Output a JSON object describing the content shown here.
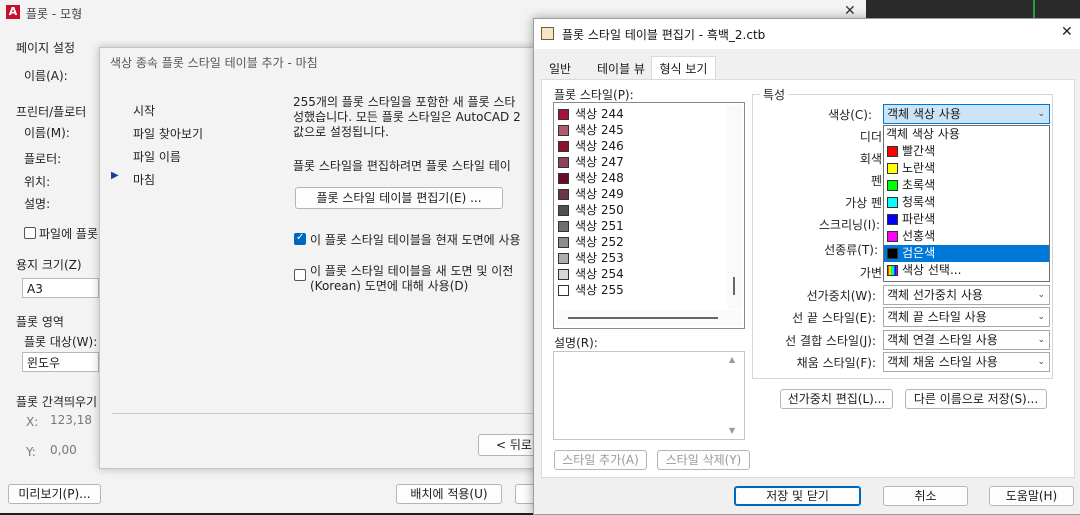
{
  "plot": {
    "title": "플롯 - 모형",
    "page_setup_group": "페이지 설정",
    "name_label": "이름(A):",
    "printer_group": "프린터/플로터",
    "printer_name_label": "이름(M):",
    "plotter_label": "플로터:",
    "location_label": "위치:",
    "description_label": "설명:",
    "plot_to_file": "파일에 플롯",
    "paper_size_group": "용지 크기(Z)",
    "paper_size_value": "A3",
    "plot_area_group": "플롯 영역",
    "plot_what_label": "플롯 대상(W):",
    "plot_what_value": "윈도우",
    "plot_offset_group": "플롯 간격띄우기",
    "x_label": "X:",
    "x_value": "123,18",
    "y_label": "Y:",
    "y_value": "0,00",
    "preview_button": "미리보기(P)...",
    "apply_layout_button": "배치에 적용(U)"
  },
  "wizard": {
    "title": "색상 종속 플롯 스타일 테이블 추가 - 마침",
    "steps": [
      "시작",
      "파일 찾아보기",
      "파일 이름",
      "마침"
    ],
    "active_step_marker": "▶",
    "info_line1": "255개의 플롯 스타일을 포함한 새 플롯 스타",
    "info_line2": "성했습니다. 모든 플롯 스타일은 AutoCAD 2",
    "info_line3": "값으로 설정됩니다.",
    "edit_hint": "플롯 스타일을 편집하려면 플롯 스타일 테이",
    "edit_button": "플롯 스타일 테이블 편집기(E) ...",
    "use_current_checkbox": "이 플롯 스타일 테이블을 현재 도면에 사용",
    "use_new_line1": "이 플롯 스타일 테이블을 새 도면 및 이전",
    "use_new_line2": "(Korean) 도면에 대해 사용(D)",
    "back_button": "< 뒤로"
  },
  "editor": {
    "title": "플롯 스타일 테이블 편집기 - 흑백_2.ctb",
    "close_glyph": "✕",
    "tabs": [
      "일반",
      "테이블 뷰",
      "형식 보기"
    ],
    "active_tab": "형식 보기",
    "plot_styles_label": "플롯 스타일(P):",
    "styles": [
      {
        "name": "색상 244",
        "color": "#a8123a"
      },
      {
        "name": "색상 245",
        "color": "#b25a6e"
      },
      {
        "name": "색상 246",
        "color": "#8e0f2e"
      },
      {
        "name": "색상 247",
        "color": "#8e4358"
      },
      {
        "name": "색상 248",
        "color": "#6d0c24"
      },
      {
        "name": "색상 249",
        "color": "#6d3544"
      },
      {
        "name": "색상 250",
        "color": "#4f4f4f"
      },
      {
        "name": "색상 251",
        "color": "#6f6f6f"
      },
      {
        "name": "색상 252",
        "color": "#8c8c8c"
      },
      {
        "name": "색상 253",
        "color": "#adadad"
      },
      {
        "name": "색상 254",
        "color": "#d6d6d6"
      },
      {
        "name": "색상 255",
        "color": "#ffffff"
      }
    ],
    "description_label": "설명(R):",
    "add_style_button": "스타일 추가(A)",
    "delete_style_button": "스타일 삭제(Y)",
    "properties_group": "특성",
    "color_label": "색상(C):",
    "color_value": "객체 색상 사용",
    "partial_labels": [
      "디더",
      "회색",
      "펜",
      "가상 펜",
      "스크리닝(I):",
      "선종류(T):",
      "가변"
    ],
    "lineweight_label": "선가중치(W):",
    "lineweight_value": "객체 선가중치 사용",
    "line_end_label": "선 끝 스타일(E):",
    "line_end_value": "객체 끝 스타일 사용",
    "line_join_label": "선 결합 스타일(J):",
    "line_join_value": "객체 연결 스타일 사용",
    "fill_label": "채움 스타일(F):",
    "fill_value": "객체 채움 스타일 사용",
    "edit_lineweights_button": "선가중치 편집(L)...",
    "save_as_button": "다른 이름으로 저장(S)...",
    "save_close_button": "저장 및 닫기",
    "cancel_button": "취소",
    "help_button": "도움말(H)",
    "color_options": [
      {
        "label": "객체 색상 사용",
        "swatch": ""
      },
      {
        "label": "빨간색",
        "swatch": "#ff0000"
      },
      {
        "label": "노란색",
        "swatch": "#ffff00"
      },
      {
        "label": "초록색",
        "swatch": "#00ff00"
      },
      {
        "label": "청록색",
        "swatch": "#00ffff"
      },
      {
        "label": "파란색",
        "swatch": "#0000ff"
      },
      {
        "label": "선홍색",
        "swatch": "#ff00ff"
      },
      {
        "label": "검은색",
        "swatch": "#000000"
      },
      {
        "label": "색상 선택...",
        "swatch": "multicolor"
      }
    ],
    "selected_color_option": "검은색"
  }
}
